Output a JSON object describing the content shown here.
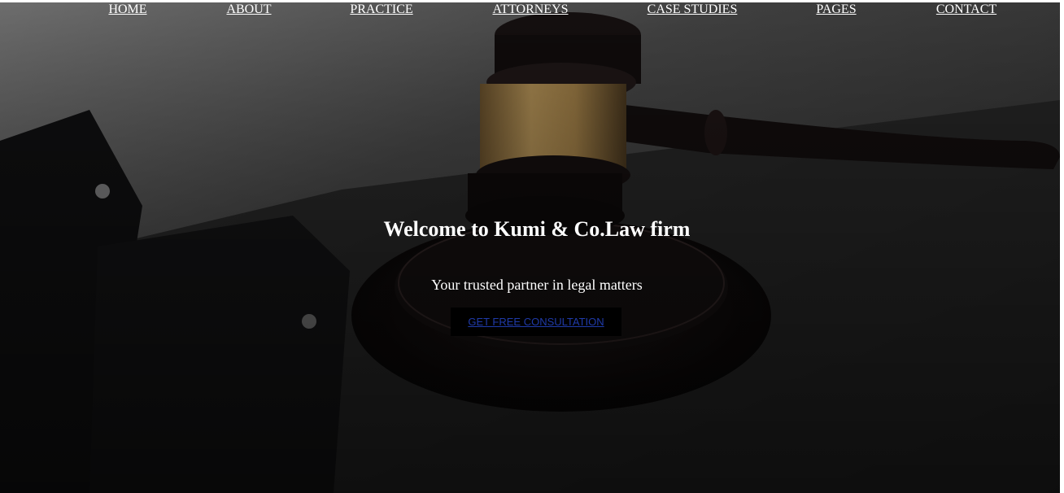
{
  "nav": {
    "items": [
      {
        "label": "HOME"
      },
      {
        "label": "ABOUT"
      },
      {
        "label": "PRACTICE"
      },
      {
        "label": "ATTORNEYS"
      },
      {
        "label": "CASE STUDIES"
      },
      {
        "label": "PAGES"
      },
      {
        "label": "CONTACT"
      }
    ]
  },
  "hero": {
    "title": "Welcome to Kumi & Co.Law firm",
    "subtitle": "Your trusted partner in legal matters",
    "cta_label": "GET FREE CONSULTATION",
    "background": "gavel-photo"
  },
  "colors": {
    "link_text": "#ffffff",
    "cta_background": "#000000",
    "cta_link": "#1f3aa8"
  }
}
